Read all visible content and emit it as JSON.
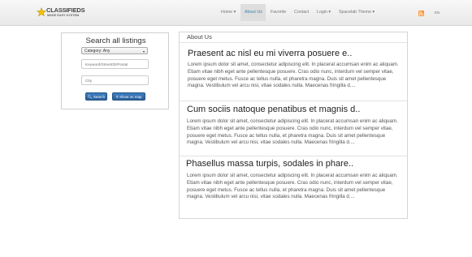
{
  "brand": {
    "line1": "CLASSIFIEDS",
    "line2": "MADE EASY SYSTEM"
  },
  "nav": {
    "items": [
      {
        "label": "Home ▾"
      },
      {
        "label": "About Us",
        "active": true
      },
      {
        "label": "Favorite"
      },
      {
        "label": "Contact"
      },
      {
        "label": "Login ▾"
      },
      {
        "label": "Spacelab Theme ▾"
      }
    ],
    "rss_icon": "rss-icon",
    "language": "EN"
  },
  "search": {
    "title": "Search all listings",
    "category_value": "Category: Any",
    "keyword_placeholder": "Keyword/Street/ID/Postal",
    "city_placeholder": "City",
    "search_button": "Search",
    "map_button": "Show on map"
  },
  "page": {
    "heading": "About Us",
    "articles": [
      {
        "title": "Praesent ac nisl eu mi viverra posuere e..",
        "body": "Lorem ipsum dolor sit amet, consectetur adipiscing elit. In placerat accumsan enim ac aliquam. Etiam vitae nibh eget ante pellentesque posuere. Cras odio nunc, interdum vel semper vitae, posuere eget metus. Fusce ac tellus nulla, et pharetra magna. Duis sit amet pellentesque magna. Vestibulum vel arcu nisi, vitae sodales nulla. Maecenas fringilla d...."
      },
      {
        "title": "Cum sociis natoque penatibus et magnis d..",
        "body": "Lorem ipsum dolor sit amet, consectetur adipiscing elit. In placerat accumsan enim ac aliquam. Etiam vitae nibh eget ante pellentesque posuere. Cras odio nunc, interdum vel semper vitae, posuere eget metus. Fusce ac tellus nulla, et pharetra magna. Duis sit amet pellentesque magna. Vestibulum vel arcu nisi, vitae sodales nulla. Maecenas fringilla d...."
      },
      {
        "title": "Phasellus massa turpis, sodales in phare..",
        "body": "Lorem ipsum dolor sit amet, consectetur adipiscing elit. In placerat accumsan enim ac aliquam. Etiam vitae nibh eget ante pellentesque posuere. Cras odio nunc, interdum vel semper vitae, posuere eget metus. Fusce ac tellus nulla, et pharetra magna. Duis sit amet pellentesque magna. Vestibulum vel arcu nisi, vitae sodales nulla. Maecenas fringilla d...."
      }
    ]
  },
  "colors": {
    "accent": "#3a87ad",
    "button": "#2f6bab",
    "rss": "#f7902b"
  }
}
